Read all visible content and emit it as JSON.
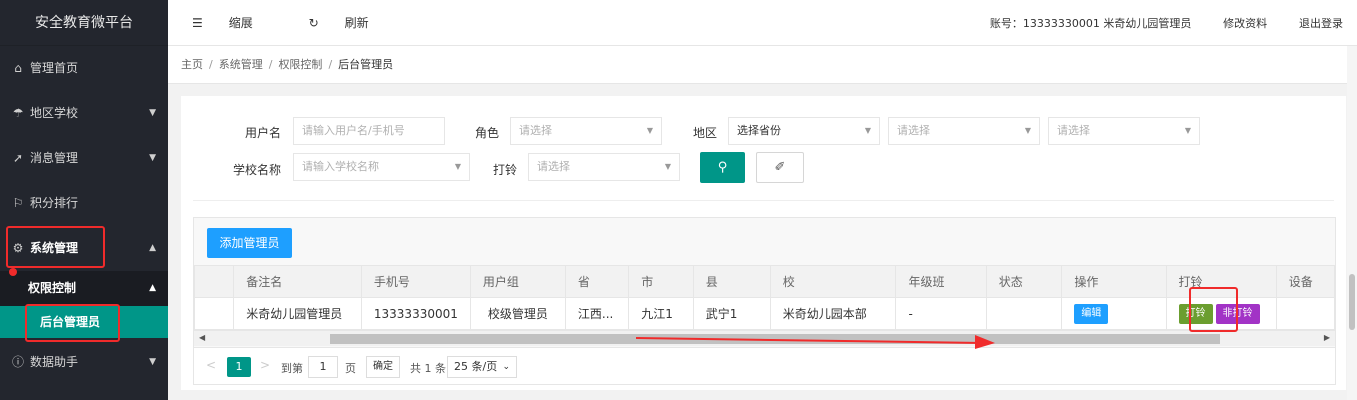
{
  "sidebar": {
    "title": "安全教育微平台",
    "items": [
      {
        "label": "管理首页",
        "icon": "home-icon",
        "glyph": "⌂"
      },
      {
        "label": "地区学校",
        "icon": "umbrella-icon",
        "glyph": "☂"
      },
      {
        "label": "消息管理",
        "icon": "send-icon",
        "glyph": "➚"
      },
      {
        "label": "积分排行",
        "icon": "flag-icon",
        "glyph": "⚐"
      },
      {
        "label": "系统管理",
        "icon": "gear-icon",
        "glyph": "⚙"
      },
      {
        "label": "数据助手",
        "icon": "info-icon",
        "glyph": "ⓘ"
      }
    ],
    "sub_item": "权限控制",
    "leaf_item": "后台管理员"
  },
  "topbar": {
    "collapse_label": "缩展",
    "refresh_label": "刷新",
    "account": "账号：13333330001  米奇幼儿园管理员",
    "profile_label": "修改资料",
    "logout_label": "退出登录"
  },
  "breadcrumb": {
    "items": [
      "主页",
      "系统管理",
      "权限控制",
      "后台管理员"
    ]
  },
  "filters": {
    "username_label": "用户名",
    "username_placeholder": "请输入用户名/手机号",
    "role_label": "角色",
    "role_placeholder": "请选择",
    "region_label": "地区",
    "province_value": "选择省份",
    "city_placeholder": "请选择",
    "county_placeholder": "请选择",
    "school_label": "学校名称",
    "school_placeholder": "请输入学校名称",
    "ring_label": "打铃",
    "ring_placeholder": "请选择"
  },
  "table": {
    "add_button": "添加管理员",
    "headers": [
      "备注名",
      "手机号",
      "用户组",
      "省",
      "市",
      "县",
      "校",
      "年级班",
      "状态",
      "操作",
      "打铃",
      "设备"
    ],
    "row": {
      "name": "米奇幼儿园管理员",
      "phone": "13333330001",
      "group": "校级管理员",
      "province": "江西...",
      "city": "九江1",
      "county": "武宁1",
      "school": "米奇幼儿园本部",
      "grade": "-",
      "status": "",
      "edit_button": "编辑",
      "ring_button": "打铃",
      "noring_button": "非打铃"
    }
  },
  "pager": {
    "current_page": "1",
    "goto_label": "到第",
    "goto_value": "1",
    "page_label": "页",
    "confirm_label": "确定",
    "total": "共 1 条",
    "page_size": "25 条/页"
  },
  "colors": {
    "sidebar_bg": "#23262e",
    "accent_teal": "#009688",
    "accent_blue": "#1e9fff",
    "ring_green": "#6b9e2f",
    "noring_purple": "#a233c6",
    "annotation_red": "#f02b2b"
  }
}
